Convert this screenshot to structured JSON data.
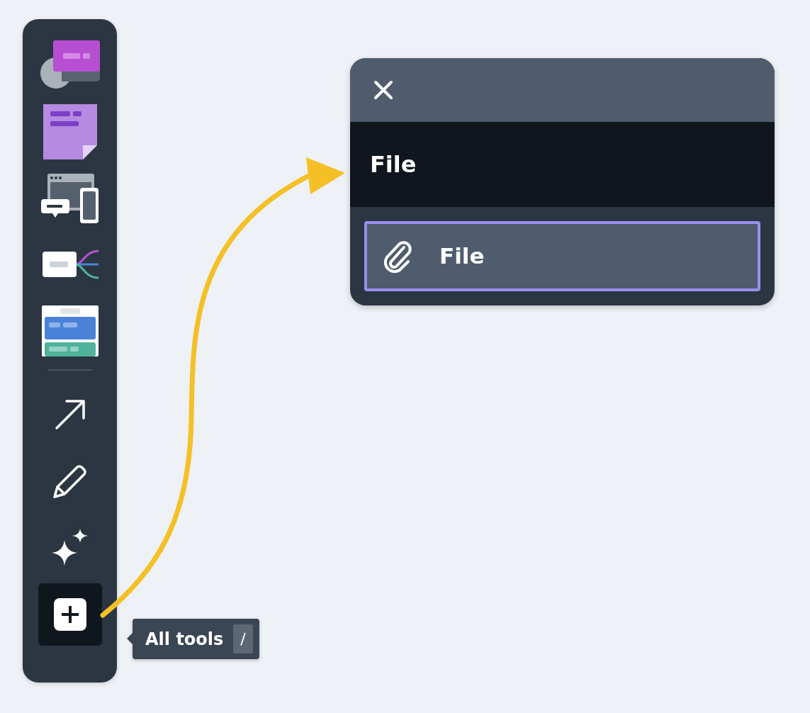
{
  "toolbar": {
    "groups": [
      [
        {
          "selected": false
        },
        {
          "selected": false
        },
        {
          "selected": false
        },
        {
          "selected": false
        },
        {
          "selected": false
        }
      ],
      [
        {
          "selected": false
        },
        {
          "selected": false
        },
        {
          "selected": false
        },
        {
          "selected": true
        }
      ]
    ]
  },
  "tooltip": {
    "label": "All tools",
    "shortcut": "/"
  },
  "search_panel": {
    "value": "File",
    "results": [
      {
        "label": "File",
        "selected": true
      }
    ]
  }
}
